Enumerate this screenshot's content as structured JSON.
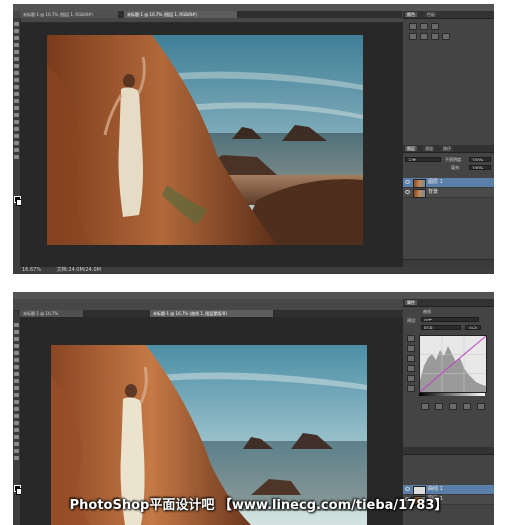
{
  "screenshot_top": {
    "menubar_text": "PS ...",
    "tabs": [
      {
        "label": "未标题-1 @ 16.7% (图层 1, RGB/8#)",
        "active": false
      },
      {
        "label": "未标题-1 @ 16.7% (图层 1, RGB/8#)",
        "active": true
      }
    ],
    "panel_tabs": [
      "颜色",
      "色板"
    ],
    "layers_panel_tabs": [
      "图层",
      "通道",
      "路径"
    ],
    "blend_mode": "正常",
    "opacity_label": "不透明度:",
    "opacity_value": "100%",
    "fill_label": "填充:",
    "fill_value": "100%",
    "layers": [
      {
        "name": "图层 1",
        "selected": true
      },
      {
        "name": "背景",
        "selected": false
      }
    ],
    "status_zoom": "16.67%",
    "status_doc": "文档:24.0M/24.0M"
  },
  "screenshot_bottom": {
    "tabs": [
      {
        "label": "未标题-1 @ 16.7%",
        "active": false
      },
      {
        "label": "未标题-1 @ 16.7% (曲线 1, 图层蒙版/8)",
        "active": true
      }
    ],
    "properties_title": "属性",
    "curves_label": "曲线",
    "preset_label": "预设:",
    "preset_value": "自定",
    "channel_value": "RGB",
    "auto_button": "自动",
    "layers": [
      {
        "name": "曲线 1",
        "selected": true
      },
      {
        "name": "图层 1",
        "selected": false
      }
    ]
  },
  "watermark": "PhotoShop平面设计吧 【www.linecg.com/tieba/1783】",
  "colors": {
    "ps_dark": "#3a3a3a",
    "panel": "#444444",
    "selected_layer": "#5a7fa8",
    "curve_line": "#c040c0"
  }
}
